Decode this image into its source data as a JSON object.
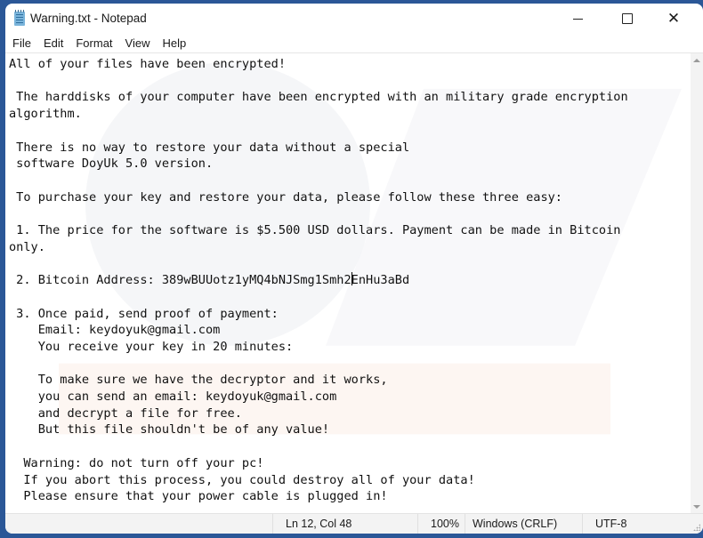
{
  "window": {
    "title": "Warning.txt - Notepad",
    "app_icon": "notepad-icon",
    "controls": {
      "minimize": "minimize-icon",
      "maximize": "maximize-icon",
      "close": "close-icon",
      "close_glyph": "✕"
    }
  },
  "menu": {
    "items": [
      {
        "label": "File"
      },
      {
        "label": "Edit"
      },
      {
        "label": "Format"
      },
      {
        "label": "View"
      },
      {
        "label": "Help"
      }
    ]
  },
  "editor": {
    "text_before_caret": "All of your files have been encrypted!\n\n The harddisks of your computer have been encrypted with an military grade encryption\nalgorithm.\n\n There is no way to restore your data without a special\n software DoyUk 5.0 version.\n\n To purchase your key and restore your data, please follow these three easy:\n\n 1. The price for the software is $5.500 USD dollars. Payment can be made in Bitcoin\nonly.\n\n 2. Bitcoin Address: 389wBUUotz1yMQ4bNJSmg1Smh2",
    "text_after_caret": "EnHu3aBd\n\n 3. Once paid, send proof of payment:\n    Email: keydoyuk@gmail.com\n    You receive your key in 20 minutes:\n\n    To make sure we have the decryptor and it works,\n    you can send an email: keydoyuk@gmail.com\n    and decrypt a file for free.\n    But this file shouldn't be of any value!\n\n  Warning: do not turn off your pc!\n  If you abort this process, you could destroy all of your data!\n  Please ensure that your power cable is plugged in!"
  },
  "statusbar": {
    "position": "Ln 12, Col 48",
    "zoom": "100%",
    "line_ending": "Windows (CRLF)",
    "encoding": "UTF-8"
  }
}
